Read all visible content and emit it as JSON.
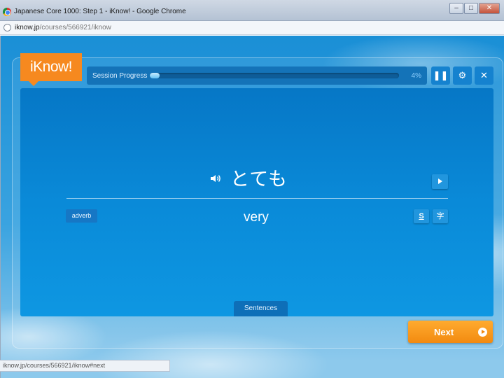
{
  "window": {
    "title": "Japanese Core 1000: Step 1 - iKnow! - Google Chrome",
    "minimize": "–",
    "maximize": "□",
    "close": "✕"
  },
  "address": {
    "host": "iknow.jp",
    "path": "/courses/566921/iknow"
  },
  "app": {
    "logo": "iKnow!",
    "progress_label": "Session Progress",
    "progress_percent": "4%",
    "progress_fraction": 0.04,
    "controls": {
      "pause": "❚❚",
      "settings": "⚙",
      "close": "✕"
    }
  },
  "card": {
    "word": "とても",
    "speaker_icon": "speaker-icon",
    "part_of_speech": "adverb",
    "meaning": "very",
    "sound_button": "S",
    "kana_button": "字",
    "sentences_tab": "Sentences"
  },
  "next_button": "Next",
  "status_bar": "iknow.jp/courses/566921/iknow#next"
}
